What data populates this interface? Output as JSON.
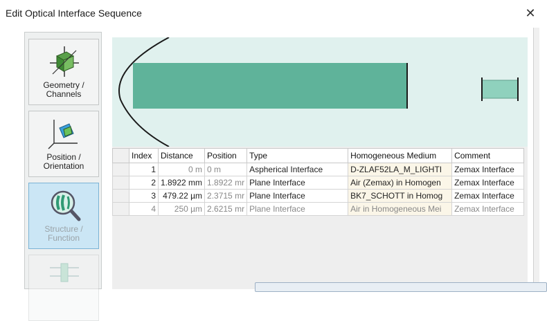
{
  "window": {
    "title": "Edit Optical Interface Sequence",
    "close_glyph": "✕"
  },
  "nav": [
    {
      "label_line1": "Geometry /",
      "label_line2": "Channels",
      "icon": "geometry-cube-icon",
      "active": false
    },
    {
      "label_line1": "Position /",
      "label_line2": "Orientation",
      "icon": "position-axes-icon",
      "active": false
    },
    {
      "label_line1": "Structure /",
      "label_line2": "Function",
      "icon": "structure-lens-icon",
      "active": true
    },
    {
      "label_line1": "",
      "label_line2": "",
      "icon": "channel-flow-icon",
      "active": false
    }
  ],
  "colors": {
    "preview_bg": "#e0f1ee",
    "lens_fill": "#5fb39a",
    "selected_nav": "#cbe6f5",
    "medium_cell": "#fbf6e8"
  },
  "table": {
    "headers": [
      "Index",
      "Distance",
      "Position",
      "Type",
      "Homogeneous Medium",
      "Comment"
    ],
    "rows": [
      {
        "index": "1",
        "distance": "0 m",
        "position": "0 m",
        "type": "Aspherical Interface",
        "medium": "D-ZLAF52LA_M_LIGHTI",
        "comment": "Zemax Interface"
      },
      {
        "index": "2",
        "distance": "1.8922 mm",
        "position": "1.8922 mr",
        "type": "Plane Interface",
        "medium": "Air (Zemax) in Homogen",
        "comment": "Zemax Interface"
      },
      {
        "index": "3",
        "distance": "479.22 µm",
        "position": "2.3715 mr",
        "type": "Plane Interface",
        "medium": "BK7_SCHOTT in Homog",
        "comment": "Zemax Interface"
      },
      {
        "index": "4",
        "distance": "250 µm",
        "position": "2.6215 mr",
        "type": "Plane Interface",
        "medium": "Air in Homogeneous Mei",
        "comment": "Zemax Interface"
      }
    ]
  }
}
